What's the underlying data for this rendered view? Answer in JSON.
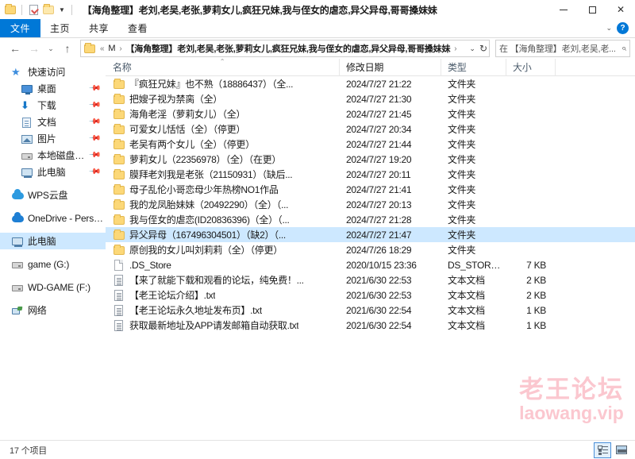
{
  "titlebar": {
    "title": "【海角整理】老刘,老吴,老张,萝莉女儿,疯狂兄妹,我与侄女的虐恋,异父异母,哥哥搡妹妹",
    "minimize": "—",
    "maximize": "□",
    "close": "✕"
  },
  "ribbon": {
    "tabs": [
      {
        "label": "文件",
        "active": true
      },
      {
        "label": "主页",
        "active": false
      },
      {
        "label": "共享",
        "active": false
      },
      {
        "label": "查看",
        "active": false
      }
    ],
    "help": "?"
  },
  "navbar": {
    "back": "←",
    "forward": "→",
    "recent": "⌄",
    "up": "↑",
    "breadcrumb": [
      {
        "label": "«",
        "type": "overflow"
      },
      {
        "label": "M",
        "type": "crumb"
      },
      {
        "label": "›",
        "type": "sep"
      },
      {
        "label": "【海角整理】老刘,老吴,老张,萝莉女儿,疯狂兄妹,我与侄女的虐恋,异父异母,哥哥搡妹妹",
        "type": "crumb-current"
      },
      {
        "label": "›",
        "type": "sep"
      }
    ],
    "dropdown": "⌄",
    "refresh": "↻",
    "search_placeholder": "在 【海角整理】老刘,老吴,老...",
    "search_value": ""
  },
  "sidebar": {
    "items": [
      {
        "label": "快速访问",
        "icon": "star-icon",
        "indent": false,
        "pinned": false,
        "selected": false,
        "gap": false
      },
      {
        "label": "桌面",
        "icon": "desktop-icon",
        "indent": true,
        "pinned": true,
        "selected": false,
        "gap": false
      },
      {
        "label": "下载",
        "icon": "downloads-icon",
        "indent": true,
        "pinned": true,
        "selected": false,
        "gap": false
      },
      {
        "label": "文档",
        "icon": "documents-icon",
        "indent": true,
        "pinned": true,
        "selected": false,
        "gap": false
      },
      {
        "label": "图片",
        "icon": "pictures-icon",
        "indent": true,
        "pinned": true,
        "selected": false,
        "gap": false
      },
      {
        "label": "本地磁盘 (D:)",
        "icon": "drive-icon",
        "indent": true,
        "pinned": true,
        "selected": false,
        "gap": false
      },
      {
        "label": "此电脑",
        "icon": "this-pc-icon",
        "indent": true,
        "pinned": true,
        "selected": false,
        "gap": false
      },
      {
        "label": "WPS云盘",
        "icon": "wps-cloud-icon",
        "indent": false,
        "pinned": false,
        "selected": false,
        "gap": true
      },
      {
        "label": "OneDrive - Persona",
        "icon": "onedrive-icon",
        "indent": false,
        "pinned": false,
        "selected": false,
        "gap": true
      },
      {
        "label": "此电脑",
        "icon": "this-pc-icon",
        "indent": false,
        "pinned": false,
        "selected": true,
        "gap": true
      },
      {
        "label": "game (G:)",
        "icon": "drive-icon",
        "indent": false,
        "pinned": false,
        "selected": false,
        "gap": true
      },
      {
        "label": "WD-GAME (F:)",
        "icon": "drive-icon",
        "indent": false,
        "pinned": false,
        "selected": false,
        "gap": true
      },
      {
        "label": "网络",
        "icon": "network-icon",
        "indent": false,
        "pinned": false,
        "selected": false,
        "gap": true
      }
    ]
  },
  "filelist": {
    "columns": [
      {
        "key": "name",
        "label": "名称",
        "sorted": true
      },
      {
        "key": "date",
        "label": "修改日期",
        "sorted": false
      },
      {
        "key": "type",
        "label": "类型",
        "sorted": false
      },
      {
        "key": "size",
        "label": "大小",
        "sorted": false
      }
    ],
    "sort_indicator": "⌃",
    "rows": [
      {
        "name": "『疯狂兄妹』也不熟（18886437）（全...",
        "date": "2024/7/27 21:22",
        "type": "文件夹",
        "size": "",
        "icon": "folder-icon",
        "selected": false
      },
      {
        "name": "把嫂子视为禁脔（全）",
        "date": "2024/7/27 21:30",
        "type": "文件夹",
        "size": "",
        "icon": "folder-icon",
        "selected": false
      },
      {
        "name": "海角老淫（萝莉女儿）（全）",
        "date": "2024/7/27 21:45",
        "type": "文件夹",
        "size": "",
        "icon": "folder-icon",
        "selected": false
      },
      {
        "name": "可爱女儿恬恬（全）（停更）",
        "date": "2024/7/27 20:34",
        "type": "文件夹",
        "size": "",
        "icon": "folder-icon",
        "selected": false
      },
      {
        "name": "老吴有两个女儿（全）（停更）",
        "date": "2024/7/27 21:44",
        "type": "文件夹",
        "size": "",
        "icon": "folder-icon",
        "selected": false
      },
      {
        "name": "萝莉女儿（22356978）（全）（在更）",
        "date": "2024/7/27 19:20",
        "type": "文件夹",
        "size": "",
        "icon": "folder-icon",
        "selected": false
      },
      {
        "name": "膜拜老刘我是老张（21150931）（缺后...",
        "date": "2024/7/27 20:11",
        "type": "文件夹",
        "size": "",
        "icon": "folder-icon",
        "selected": false
      },
      {
        "name": "母子乱伦小哥恋母少年热榜NO1作品",
        "date": "2024/7/27 21:41",
        "type": "文件夹",
        "size": "",
        "icon": "folder-icon",
        "selected": false
      },
      {
        "name": "我的龙凤胎妹妹（20492290）（全）（...",
        "date": "2024/7/27 20:13",
        "type": "文件夹",
        "size": "",
        "icon": "folder-icon",
        "selected": false
      },
      {
        "name": "我与侄女的虐恋(ID20836396)（全）（...",
        "date": "2024/7/27 21:28",
        "type": "文件夹",
        "size": "",
        "icon": "folder-icon",
        "selected": false
      },
      {
        "name": "异父异母（167496304501）（缺2）（...",
        "date": "2024/7/27 21:47",
        "type": "文件夹",
        "size": "",
        "icon": "folder-icon",
        "selected": true
      },
      {
        "name": "原创我的女儿叫刘莉莉（全）（停更）",
        "date": "2024/7/26 18:29",
        "type": "文件夹",
        "size": "",
        "icon": "folder-icon",
        "selected": false
      },
      {
        "name": ".DS_Store",
        "date": "2020/10/15 23:36",
        "type": "DS_STORE 文件",
        "size": "7 KB",
        "icon": "file-icon",
        "selected": false
      },
      {
        "name": "【来了就能下载和观看的论坛，纯免费！...",
        "date": "2021/6/30 22:53",
        "type": "文本文档",
        "size": "2 KB",
        "icon": "text-file-icon",
        "selected": false
      },
      {
        "name": "【老王论坛介绍】.txt",
        "date": "2021/6/30 22:53",
        "type": "文本文档",
        "size": "2 KB",
        "icon": "text-file-icon",
        "selected": false
      },
      {
        "name": "【老王论坛永久地址发布页】.txt",
        "date": "2021/6/30 22:54",
        "type": "文本文档",
        "size": "1 KB",
        "icon": "text-file-icon",
        "selected": false
      },
      {
        "name": "获取最新地址及APP请发邮箱自动获取.txt",
        "date": "2021/6/30 22:54",
        "type": "文本文档",
        "size": "1 KB",
        "icon": "text-file-icon",
        "selected": false
      }
    ]
  },
  "watermark": {
    "line1": "老王论坛",
    "line2": "laowang.vip",
    "color": "#fbc7cf"
  },
  "statusbar": {
    "item_count": "17 个项目",
    "views": [
      {
        "name": "details-view",
        "active": true
      },
      {
        "name": "large-icons-view",
        "active": false
      }
    ]
  }
}
